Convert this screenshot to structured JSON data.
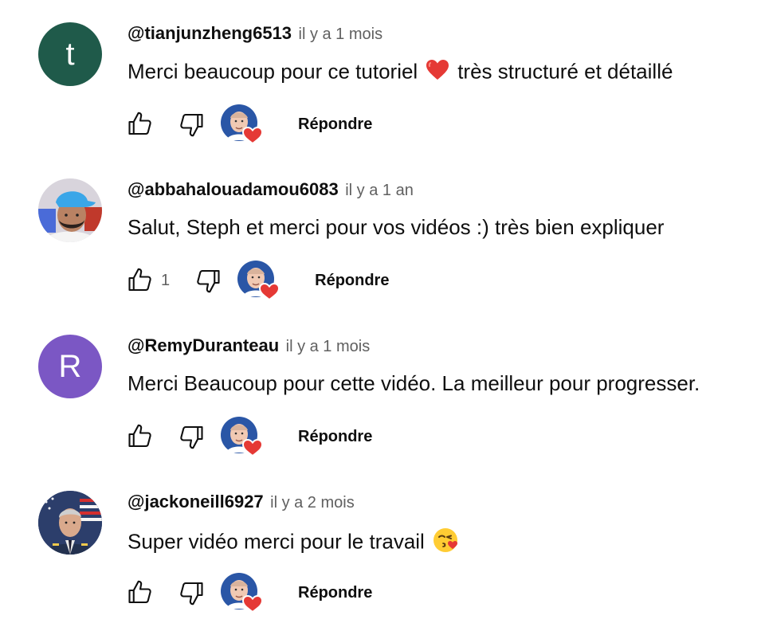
{
  "comments": [
    {
      "author": "@tianjunzheng6513",
      "time": "il y a 1 mois",
      "text_before": "Merci beaucoup pour ce tutoriel",
      "emoji": "red-heart",
      "text_after": "très structuré et détaillé",
      "avatar": {
        "type": "initial",
        "letter": "t",
        "color": "#1f5a4a"
      },
      "likes": "",
      "reply_label": "Répondre"
    },
    {
      "author": "@abbahalouadamou6083",
      "time": "il y a 1 an",
      "text_before": "Salut, Steph et merci pour vos vidéos :) très bien expliquer",
      "emoji": "",
      "text_after": "",
      "avatar": {
        "type": "photo",
        "icon": "person-blue-cap-photo"
      },
      "likes": "1",
      "reply_label": "Répondre"
    },
    {
      "author": "@RemyDuranteau",
      "time": "il y a 1 mois",
      "text_before": "Merci Beaucoup pour cette vidéo. La meilleur pour progresser.",
      "emoji": "",
      "text_after": "",
      "avatar": {
        "type": "initial",
        "letter": "R",
        "color": "#7b57c4"
      },
      "likes": "",
      "reply_label": "Répondre"
    },
    {
      "author": "@jackoneill6927",
      "time": "il y a 2 mois",
      "text_before": "Super vidéo merci pour le travail",
      "emoji": "face-blowing-kiss",
      "text_after": "",
      "avatar": {
        "type": "photo",
        "icon": "officer-flag-photo"
      },
      "likes": "",
      "reply_label": "Répondre"
    }
  ],
  "colors": {
    "text": "#0f0f0f",
    "secondary": "#606060",
    "heart": "#e53935",
    "creator_avatar_bg": "#2a56a6"
  }
}
